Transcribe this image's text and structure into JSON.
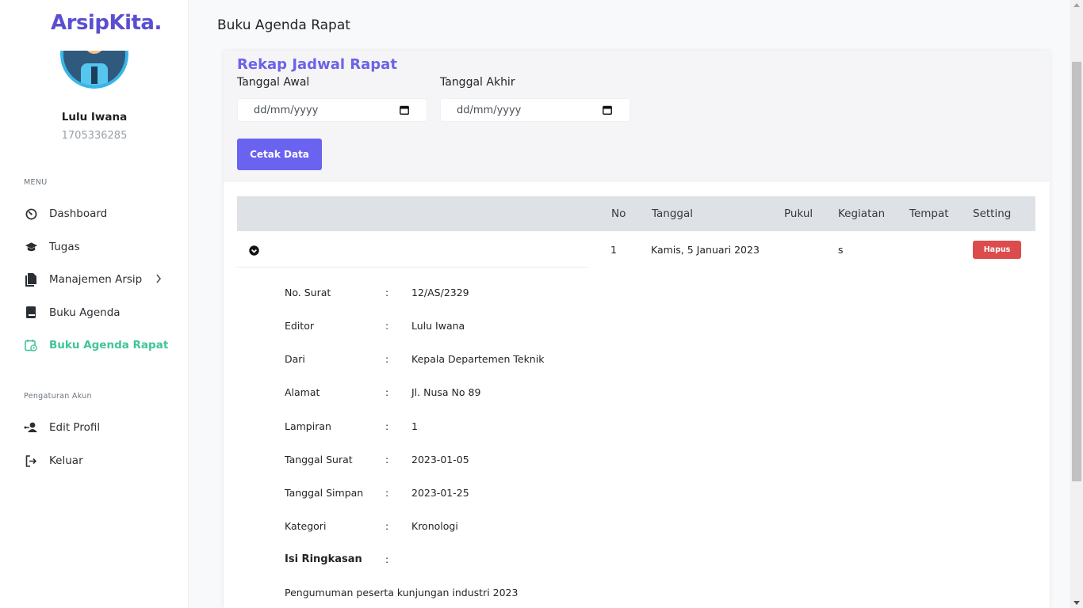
{
  "brand": "ArsipKita.",
  "user": {
    "name": "Lulu Iwana",
    "id": "1705336285"
  },
  "menu": {
    "heading": "MENU",
    "items": [
      {
        "label": "Dashboard",
        "icon": "gauge-icon"
      },
      {
        "label": "Tugas",
        "icon": "graduation-cap-icon"
      },
      {
        "label": "Manajemen Arsip",
        "icon": "file-icon"
      },
      {
        "label": "Buku Agenda",
        "icon": "book-icon"
      },
      {
        "label": "Buku Agenda Rapat",
        "icon": "calendar-clock-icon",
        "active": true
      }
    ]
  },
  "account": {
    "heading": "Pengaturan Akun",
    "items": [
      {
        "label": "Edit Profil",
        "icon": "user-edit-icon"
      },
      {
        "label": "Keluar",
        "icon": "logout-icon"
      }
    ]
  },
  "header": {
    "title": "Buku Agenda Rapat"
  },
  "filter": {
    "title": "Rekap Jadwal Rapat",
    "start_label": "Tanggal Awal",
    "end_label": "Tanggal Akhir",
    "start_placeholder": "dd/mm/yyyy",
    "end_placeholder": "dd/mm/yyyy",
    "print_label": "Cetak Data"
  },
  "table": {
    "columns": [
      "No",
      "Tanggal",
      "Pukul",
      "Kegiatan",
      "Tempat",
      "Setting"
    ],
    "rows": [
      {
        "no": "1",
        "tanggal": "Kamis, 5 Januari 2023",
        "pukul": "",
        "kegiatan": "s",
        "tempat": "",
        "action": "Hapus"
      }
    ]
  },
  "detail": [
    {
      "label": "No. Surat",
      "value": "12/AS/2329"
    },
    {
      "label": "Editor",
      "value": "Lulu Iwana"
    },
    {
      "label": "Dari",
      "value": "Kepala Departemen Teknik"
    },
    {
      "label": "Alamat",
      "value": "Jl. Nusa No 89"
    },
    {
      "label": "Lampiran",
      "value": "1"
    },
    {
      "label": "Tanggal Surat",
      "value": "2023-01-05"
    },
    {
      "label": "Tanggal Simpan",
      "value": "2023-01-25"
    },
    {
      "label": "Kategori",
      "value": "Kronologi"
    },
    {
      "label": "Isi Ringkasan",
      "value": ""
    }
  ],
  "summary_text": "Pengumuman peserta kunjungan industri 2023",
  "colors": {
    "accent": "#6a63f0",
    "active": "#3fc59b",
    "danger": "#dc4c4c",
    "brand": "#5a4fd1"
  }
}
